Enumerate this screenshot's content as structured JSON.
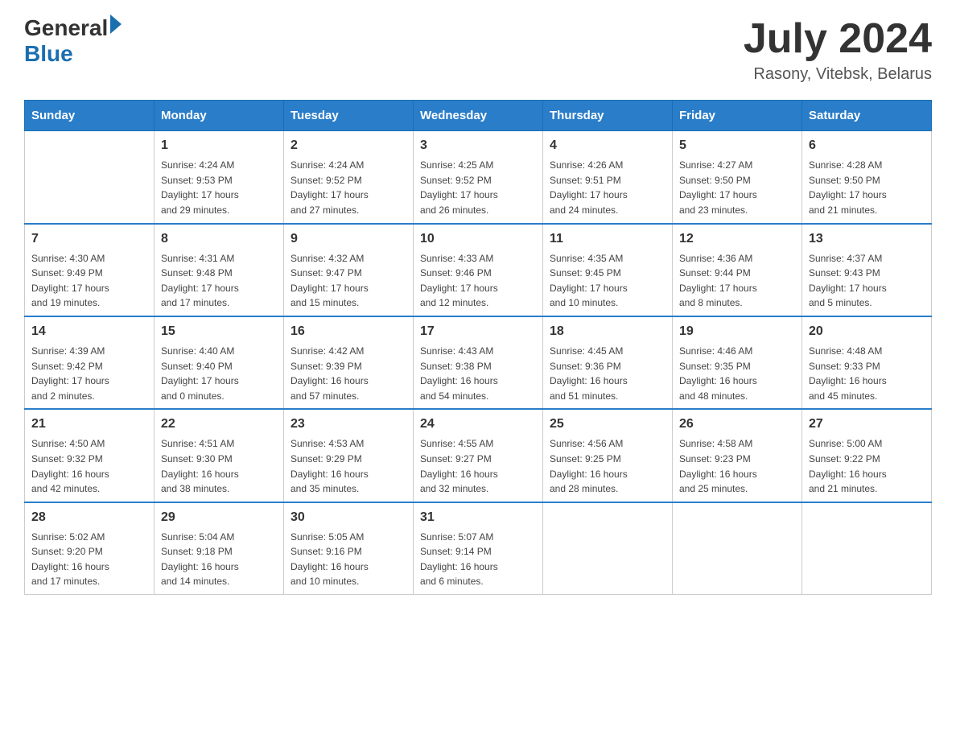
{
  "header": {
    "logo_line1": "General",
    "logo_line2": "Blue",
    "month_title": "July 2024",
    "location": "Rasony, Vitebsk, Belarus"
  },
  "weekdays": [
    "Sunday",
    "Monday",
    "Tuesday",
    "Wednesday",
    "Thursday",
    "Friday",
    "Saturday"
  ],
  "weeks": [
    [
      {
        "day": "",
        "info": ""
      },
      {
        "day": "1",
        "info": "Sunrise: 4:24 AM\nSunset: 9:53 PM\nDaylight: 17 hours\nand 29 minutes."
      },
      {
        "day": "2",
        "info": "Sunrise: 4:24 AM\nSunset: 9:52 PM\nDaylight: 17 hours\nand 27 minutes."
      },
      {
        "day": "3",
        "info": "Sunrise: 4:25 AM\nSunset: 9:52 PM\nDaylight: 17 hours\nand 26 minutes."
      },
      {
        "day": "4",
        "info": "Sunrise: 4:26 AM\nSunset: 9:51 PM\nDaylight: 17 hours\nand 24 minutes."
      },
      {
        "day": "5",
        "info": "Sunrise: 4:27 AM\nSunset: 9:50 PM\nDaylight: 17 hours\nand 23 minutes."
      },
      {
        "day": "6",
        "info": "Sunrise: 4:28 AM\nSunset: 9:50 PM\nDaylight: 17 hours\nand 21 minutes."
      }
    ],
    [
      {
        "day": "7",
        "info": "Sunrise: 4:30 AM\nSunset: 9:49 PM\nDaylight: 17 hours\nand 19 minutes."
      },
      {
        "day": "8",
        "info": "Sunrise: 4:31 AM\nSunset: 9:48 PM\nDaylight: 17 hours\nand 17 minutes."
      },
      {
        "day": "9",
        "info": "Sunrise: 4:32 AM\nSunset: 9:47 PM\nDaylight: 17 hours\nand 15 minutes."
      },
      {
        "day": "10",
        "info": "Sunrise: 4:33 AM\nSunset: 9:46 PM\nDaylight: 17 hours\nand 12 minutes."
      },
      {
        "day": "11",
        "info": "Sunrise: 4:35 AM\nSunset: 9:45 PM\nDaylight: 17 hours\nand 10 minutes."
      },
      {
        "day": "12",
        "info": "Sunrise: 4:36 AM\nSunset: 9:44 PM\nDaylight: 17 hours\nand 8 minutes."
      },
      {
        "day": "13",
        "info": "Sunrise: 4:37 AM\nSunset: 9:43 PM\nDaylight: 17 hours\nand 5 minutes."
      }
    ],
    [
      {
        "day": "14",
        "info": "Sunrise: 4:39 AM\nSunset: 9:42 PM\nDaylight: 17 hours\nand 2 minutes."
      },
      {
        "day": "15",
        "info": "Sunrise: 4:40 AM\nSunset: 9:40 PM\nDaylight: 17 hours\nand 0 minutes."
      },
      {
        "day": "16",
        "info": "Sunrise: 4:42 AM\nSunset: 9:39 PM\nDaylight: 16 hours\nand 57 minutes."
      },
      {
        "day": "17",
        "info": "Sunrise: 4:43 AM\nSunset: 9:38 PM\nDaylight: 16 hours\nand 54 minutes."
      },
      {
        "day": "18",
        "info": "Sunrise: 4:45 AM\nSunset: 9:36 PM\nDaylight: 16 hours\nand 51 minutes."
      },
      {
        "day": "19",
        "info": "Sunrise: 4:46 AM\nSunset: 9:35 PM\nDaylight: 16 hours\nand 48 minutes."
      },
      {
        "day": "20",
        "info": "Sunrise: 4:48 AM\nSunset: 9:33 PM\nDaylight: 16 hours\nand 45 minutes."
      }
    ],
    [
      {
        "day": "21",
        "info": "Sunrise: 4:50 AM\nSunset: 9:32 PM\nDaylight: 16 hours\nand 42 minutes."
      },
      {
        "day": "22",
        "info": "Sunrise: 4:51 AM\nSunset: 9:30 PM\nDaylight: 16 hours\nand 38 minutes."
      },
      {
        "day": "23",
        "info": "Sunrise: 4:53 AM\nSunset: 9:29 PM\nDaylight: 16 hours\nand 35 minutes."
      },
      {
        "day": "24",
        "info": "Sunrise: 4:55 AM\nSunset: 9:27 PM\nDaylight: 16 hours\nand 32 minutes."
      },
      {
        "day": "25",
        "info": "Sunrise: 4:56 AM\nSunset: 9:25 PM\nDaylight: 16 hours\nand 28 minutes."
      },
      {
        "day": "26",
        "info": "Sunrise: 4:58 AM\nSunset: 9:23 PM\nDaylight: 16 hours\nand 25 minutes."
      },
      {
        "day": "27",
        "info": "Sunrise: 5:00 AM\nSunset: 9:22 PM\nDaylight: 16 hours\nand 21 minutes."
      }
    ],
    [
      {
        "day": "28",
        "info": "Sunrise: 5:02 AM\nSunset: 9:20 PM\nDaylight: 16 hours\nand 17 minutes."
      },
      {
        "day": "29",
        "info": "Sunrise: 5:04 AM\nSunset: 9:18 PM\nDaylight: 16 hours\nand 14 minutes."
      },
      {
        "day": "30",
        "info": "Sunrise: 5:05 AM\nSunset: 9:16 PM\nDaylight: 16 hours\nand 10 minutes."
      },
      {
        "day": "31",
        "info": "Sunrise: 5:07 AM\nSunset: 9:14 PM\nDaylight: 16 hours\nand 6 minutes."
      },
      {
        "day": "",
        "info": ""
      },
      {
        "day": "",
        "info": ""
      },
      {
        "day": "",
        "info": ""
      }
    ]
  ]
}
